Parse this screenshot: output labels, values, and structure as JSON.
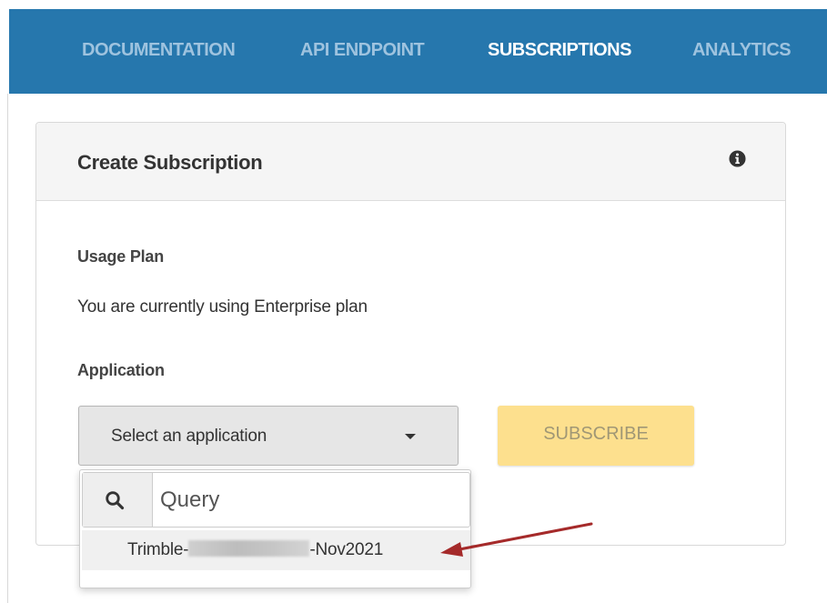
{
  "nav": {
    "items": [
      {
        "label": "DOCUMENTATION",
        "active": false
      },
      {
        "label": "API ENDPOINT",
        "active": false
      },
      {
        "label": "SUBSCRIPTIONS",
        "active": true
      },
      {
        "label": "ANALYTICS",
        "active": false
      }
    ],
    "colors": {
      "bar": "#2677ad",
      "active": "#ffffff",
      "inactive": "#9ec3df"
    }
  },
  "panel": {
    "title": "Create Subscription",
    "info_icon": "info-circle-icon"
  },
  "usage_plan": {
    "label": "Usage Plan",
    "text": "You are currently using Enterprise plan"
  },
  "application": {
    "label": "Application",
    "select_label": "Select an application",
    "caret_icon": "caret-down-icon"
  },
  "subscribe": {
    "label": "SUBSCRIBE",
    "enabled": false,
    "color": "#fde08e"
  },
  "dropdown": {
    "search_icon": "search-icon",
    "search_placeholder": "Query",
    "options": [
      {
        "prefix": "Trimble-",
        "redacted": true,
        "suffix": "-Nov2021"
      }
    ]
  },
  "annotation": {
    "arrow_color": "#a52a2a",
    "points_to": "dropdown option"
  }
}
